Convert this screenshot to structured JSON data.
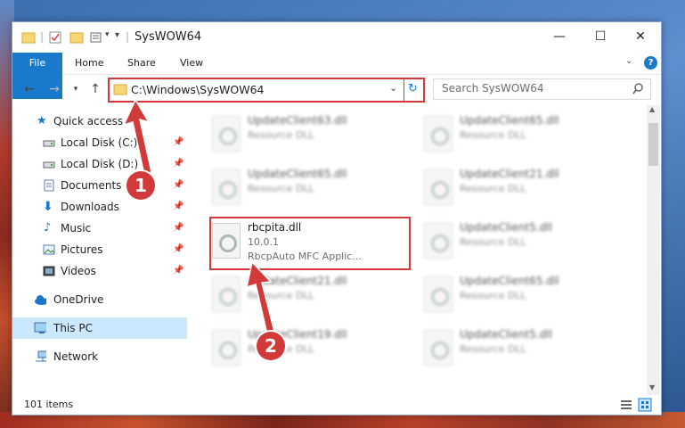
{
  "window": {
    "title": "SysWOW64",
    "minimize": "—",
    "maximize": "☐",
    "close": "✕"
  },
  "ribbon": {
    "tabs": [
      "File",
      "Home",
      "Share",
      "View"
    ],
    "help": "?"
  },
  "address": {
    "path": "C:\\Windows\\SysWOW64",
    "search_placeholder": "Search SysWOW64"
  },
  "sidebar": {
    "quick_access": "Quick access",
    "items": [
      {
        "label": "Local Disk (C:)",
        "icon": "drive-icon"
      },
      {
        "label": "Local Disk (D:)",
        "icon": "drive-icon"
      },
      {
        "label": "Documents",
        "icon": "documents-icon"
      },
      {
        "label": "Downloads",
        "icon": "downloads-icon"
      },
      {
        "label": "Music",
        "icon": "music-icon"
      },
      {
        "label": "Pictures",
        "icon": "pictures-icon"
      },
      {
        "label": "Videos",
        "icon": "videos-icon"
      }
    ],
    "onedrive": "OneDrive",
    "this_pc": "This PC",
    "network": "Network"
  },
  "files": {
    "col1": [
      {
        "name": "UpdateClient63.dll",
        "type": "Resource DLL"
      },
      {
        "name": "UpdateClient65.dll",
        "type": "Resource DLL"
      },
      {
        "name": "rbcpita.dll",
        "version": "10.0.1",
        "description": "RbcpAuto MFC Applic..."
      },
      {
        "name": "UpdateClient21.dll",
        "type": "Resource DLL"
      },
      {
        "name": "UpdateClient19.dll",
        "type": "Resource DLL"
      }
    ],
    "col2": [
      {
        "name": "UpdateClient65.dll",
        "type": "Resource DLL"
      },
      {
        "name": "UpdateClient21.dll",
        "type": "Resource DLL"
      },
      {
        "name": "UpdateClient5.dll",
        "type": "Resource DLL"
      },
      {
        "name": "UpdateClient65.dll",
        "type": "Resource DLL"
      },
      {
        "name": "UpdateClient5.dll",
        "type": "Resource DLL"
      }
    ]
  },
  "status": {
    "count": "101 items"
  },
  "callouts": [
    "1",
    "2"
  ],
  "colors": {
    "accent": "#1979ca",
    "highlight": "#d23a3a",
    "selection": "#cce8ff"
  }
}
